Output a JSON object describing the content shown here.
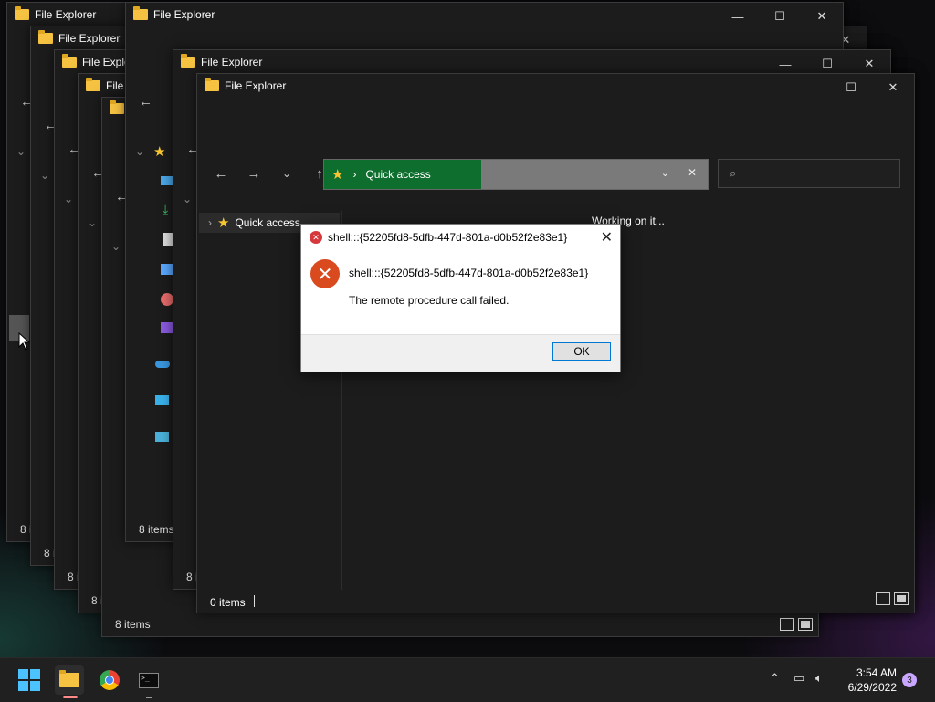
{
  "background_windows": [
    {
      "title": "File Explorer",
      "status": "8 i"
    },
    {
      "title": "File Explorer",
      "status": "8 i"
    },
    {
      "title": "File Explo",
      "status": "8 i"
    },
    {
      "title": "File Explo",
      "status": "8 i"
    },
    {
      "title": "",
      "status": "8 items"
    },
    {
      "title": "File Explorer",
      "status": "8 items"
    },
    {
      "title": "File Explorer",
      "status": "8 i"
    }
  ],
  "main_window": {
    "title": "File Explorer",
    "address": "Quick access",
    "nav_item": "Quick access",
    "content_text": "Working on it...",
    "status": "0 items"
  },
  "dialog": {
    "title": "shell:::{52205fd8-5dfb-447d-801a-d0b52f2e83e1}",
    "message_path": "shell:::{52205fd8-5dfb-447d-801a-d0b52f2e83e1}",
    "message_error": "The remote procedure call failed.",
    "ok_label": "OK"
  },
  "taskbar": {
    "time": "3:54 AM",
    "date": "6/29/2022",
    "notification_count": "3"
  },
  "icons": [
    "folder-icon",
    "star-icon",
    "error-icon",
    "search-icon",
    "windows-start-icon",
    "file-explorer-icon",
    "chrome-icon",
    "terminal-icon",
    "network-icon",
    "volume-icon"
  ]
}
